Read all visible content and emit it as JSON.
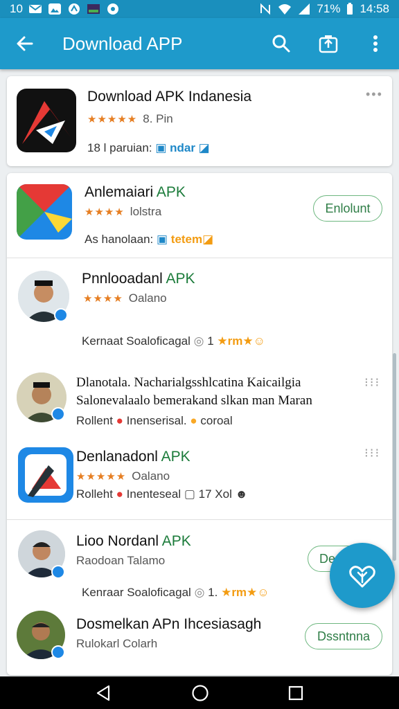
{
  "status_bar": {
    "left_text": "10",
    "battery": "71%",
    "time": "14:58"
  },
  "app_bar": {
    "title": "Download APP"
  },
  "featured": {
    "title": "Download APK Indanesia",
    "rating_text": "8. Pin",
    "meta_text": "18 l paruian:",
    "tag": "ndar"
  },
  "items": [
    {
      "title": "Anlemaiari",
      "title_apk": "APK",
      "rating_text": "lolstra",
      "meta_text": "As hanolaan:",
      "tag": "tetem",
      "button": "Enlolunt"
    },
    {
      "title": "Pnnlooadanl",
      "title_apk": "APK",
      "rating_text": "Oalano",
      "meta_text": "Kernaat Soaloficagal",
      "count": "1",
      "emoji": "rm"
    },
    {
      "title": "Dlanotala. Nacharialgsshlcatina Kaicailgia",
      "line2": "Salonevalaalo bemerakand slkan man Maran",
      "meta_text": "Rollent",
      "badge": "Inenserisal.",
      "badge2": "coroal"
    },
    {
      "title": "Denlanadonl",
      "title_apk": "APK",
      "rating_text": "Oalano",
      "meta_text": "Rolleht",
      "badge": "Inenteseal",
      "count": "17 Xol"
    },
    {
      "title": "Lioo Nordanl",
      "title_apk": "APK",
      "rating_text": "Raodoan Talamo",
      "meta_text": "Kenraar Soaloficagal",
      "count": "1.",
      "emoji": "rm",
      "button": "De"
    },
    {
      "title": "Dosmelkan APn Ihcesiasagh",
      "rating_text": "Rulokarl Colarh",
      "button": "Dssntnna"
    }
  ],
  "colors": {
    "primary": "#1e9acb",
    "status": "#1a8fbd",
    "star": "#e67e22",
    "apk_green": "#1b7b3a"
  },
  "icons": [
    "back-arrow-icon",
    "search-icon",
    "share-icon",
    "more-vert-icon",
    "heart-plant-icon"
  ]
}
